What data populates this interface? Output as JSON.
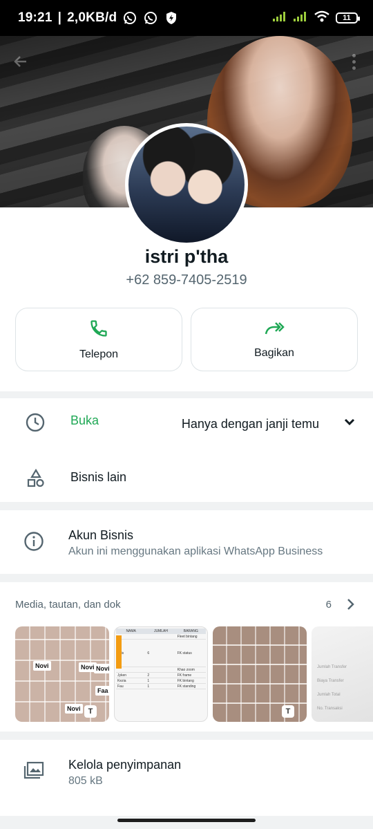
{
  "status_bar": {
    "time": "19:21",
    "separator": "|",
    "speed": "2,0KB/d",
    "battery": "11"
  },
  "profile": {
    "name": "istri p'tha",
    "phone": "+62 859-7405-2519"
  },
  "actions": {
    "call_label": "Telepon",
    "share_label": "Bagikan"
  },
  "hours": {
    "status": "Buka",
    "text": "Hanya dengan janji temu",
    "other_business": "Bisnis lain"
  },
  "business": {
    "title": "Akun Bisnis",
    "subtitle": "Akun ini menggunakan aplikasi WhatsApp Business"
  },
  "media": {
    "title": "Media, tautan, dan dok",
    "count": "6",
    "thumb1_stickers": [
      "Novi",
      "Novi",
      "Novi",
      "Faa",
      "Novi"
    ],
    "thumb_badge": "T",
    "table_headers": [
      "NAMA",
      "JUMLAH",
      "BARANG"
    ],
    "table_rows": [
      [
        "",
        "",
        "Fleet bintang"
      ],
      [
        "hois",
        "6",
        "FK status"
      ],
      [
        "",
        "",
        "Khao zoom"
      ],
      [
        "Jyken",
        "2",
        "FK frame"
      ],
      [
        "Kezia",
        "1",
        "FK bintang"
      ],
      [
        "Fau",
        "1",
        "FK standing"
      ]
    ],
    "receipt_lines": [
      "Jumlah Transfer",
      "Biaya Transfer",
      "Jumlah Total",
      "No. Transaksi"
    ]
  },
  "storage": {
    "title": "Kelola penyimpanan",
    "size": "805 kB"
  },
  "colors": {
    "accent_green": "#1fa855",
    "text_primary": "#111b21",
    "text_secondary": "#667781",
    "background": "#f0f2f3"
  }
}
